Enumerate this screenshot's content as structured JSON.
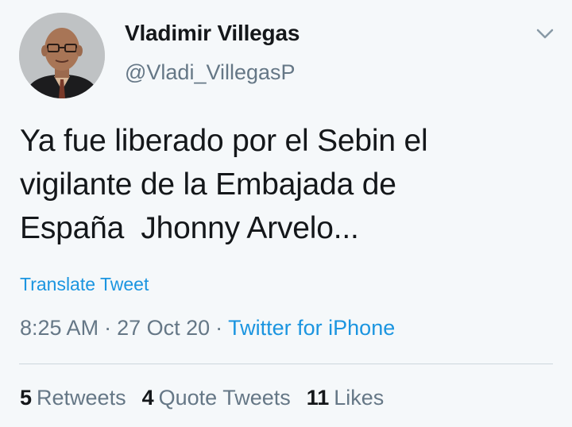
{
  "user": {
    "display_name": "Vladimir Villegas",
    "handle": "@Vladi_VillegasP",
    "avatar_icon": "user-avatar-photo"
  },
  "menu": {
    "icon": "chevron-down-icon"
  },
  "tweet": {
    "text": "Ya fue liberado por el Sebin el\nvigilante de la Embajada de\nEspaña  Jhonny Arvelo...",
    "translate_label": "Translate Tweet"
  },
  "meta": {
    "time": "8:25 AM",
    "separator": "·",
    "date": "27 Oct 20",
    "source": "Twitter for iPhone"
  },
  "stats": {
    "retweets_count": "5",
    "retweets_label": "Retweets",
    "quote_count": "4",
    "quote_label": "Quote Tweets",
    "likes_count": "11",
    "likes_label": "Likes"
  },
  "colors": {
    "background": "#f5f8fa",
    "text": "#14171a",
    "secondary": "#657786",
    "link": "#1b95e0",
    "divider": "#ccd6dd"
  }
}
